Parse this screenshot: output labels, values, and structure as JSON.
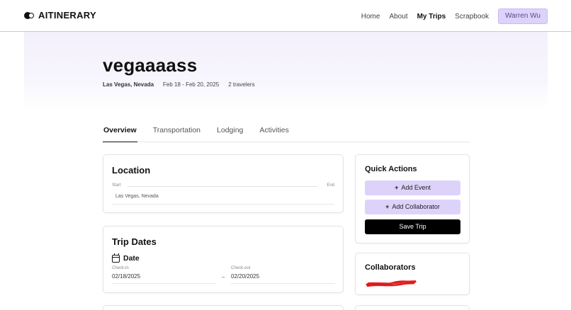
{
  "header": {
    "brand": "AITINERARY",
    "nav": [
      "Home",
      "About",
      "My Trips",
      "Scrapbook"
    ],
    "active_nav": "My Trips",
    "user": "Warren Wu"
  },
  "trip": {
    "title": "vegaaaass",
    "location": "Las Vegas, Nevada",
    "dates": "Feb 18 - Feb 20, 2025",
    "travelers": "2 travelers"
  },
  "tabs": [
    "Overview",
    "Transportation",
    "Lodging",
    "Activities"
  ],
  "active_tab": "Overview",
  "location_card": {
    "title": "Location",
    "start_label": "Start",
    "end_label": "End",
    "value": "Las Vegas, Nevada"
  },
  "dates_card": {
    "title": "Trip Dates",
    "subheading": "Date",
    "checkin_label": "Check-in",
    "checkin_value": "02/18/2025",
    "separator": "–",
    "checkout_label": "Check-out",
    "checkout_value": "02/20/2025"
  },
  "quick_actions": {
    "title": "Quick Actions",
    "add_event": "Add Event",
    "add_collaborator": "Add Collaborator",
    "save_trip": "Save Trip"
  },
  "collaborators": {
    "title": "Collaborators"
  },
  "colors": {
    "accent": "#ddd3fa",
    "primary_button": "#000000",
    "redaction": "#dd1a1a"
  },
  "icons": {
    "logo": "logo-icon",
    "calendar": "calendar-icon",
    "plus": "plus-icon"
  }
}
